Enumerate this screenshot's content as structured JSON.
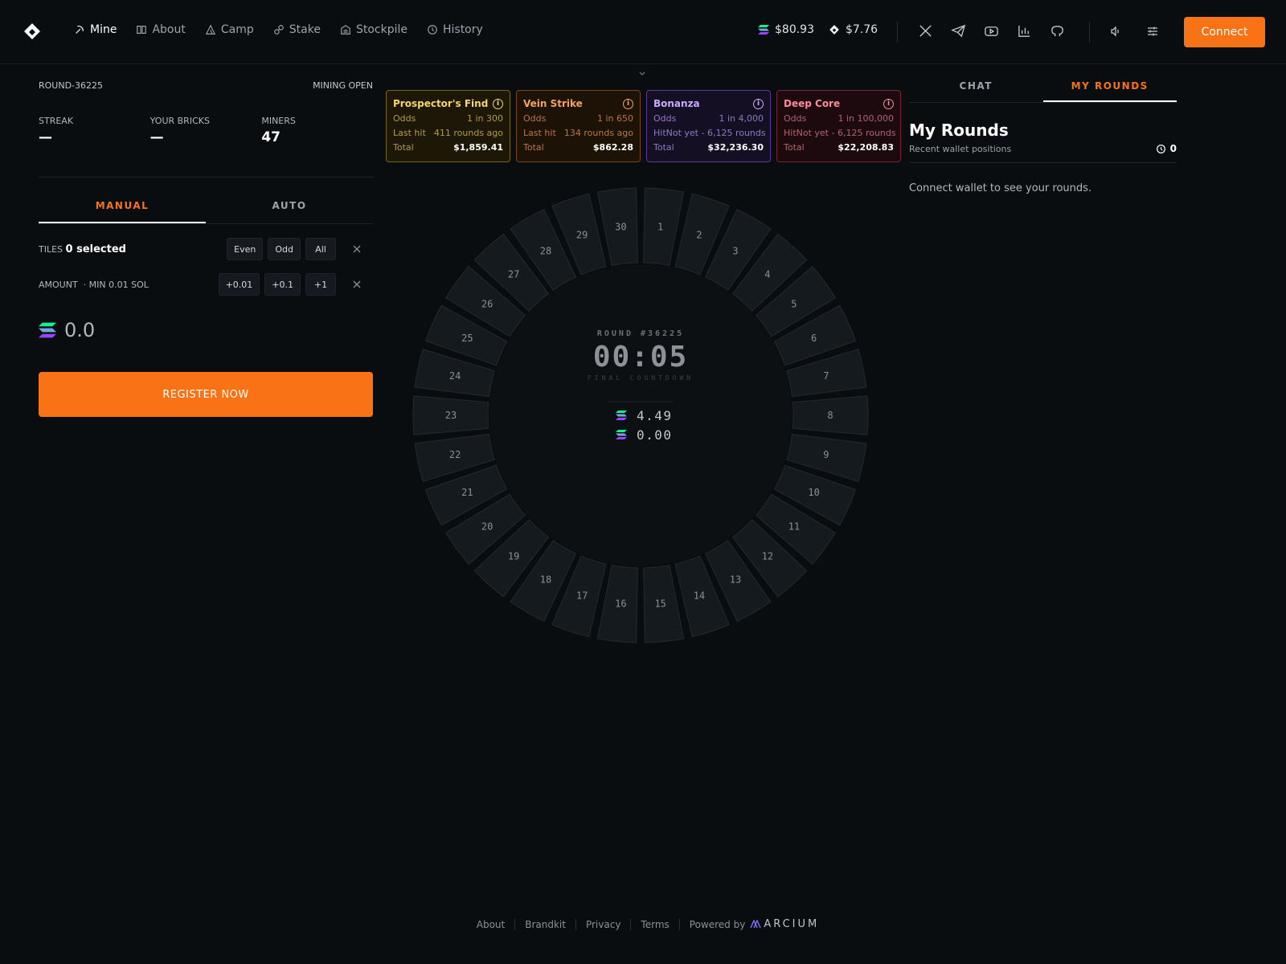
{
  "nav": {
    "items": [
      {
        "label": "Mine",
        "icon": "pickaxe-icon",
        "active": true
      },
      {
        "label": "About",
        "icon": "book-icon"
      },
      {
        "label": "Camp",
        "icon": "tent-icon"
      },
      {
        "label": "Stake",
        "icon": "link-icon"
      },
      {
        "label": "Stockpile",
        "icon": "warehouse-icon"
      },
      {
        "label": "History",
        "icon": "history-icon"
      }
    ],
    "sol_price": "$80.93",
    "token_price": "$7.76",
    "connect_label": "Connect"
  },
  "left": {
    "round_id": "ROUND-36225",
    "status": "MINING OPEN",
    "stats": [
      {
        "label": "STREAK",
        "value": "—"
      },
      {
        "label": "YOUR BRICKS",
        "value": "—"
      },
      {
        "label": "MINERS",
        "value": "47"
      }
    ],
    "tabs": {
      "manual": "MANUAL",
      "auto": "AUTO"
    },
    "tiles_label": "TILES",
    "tiles_value": "0 selected",
    "tile_buttons": [
      "Even",
      "Odd",
      "All"
    ],
    "amount_label": "AMOUNT",
    "amount_min": "· MIN 0.01 SOL",
    "amount_buttons": [
      "+0.01",
      "+0.1",
      "+1"
    ],
    "amount_value": "0.0",
    "register_label": "REGISTER NOW"
  },
  "cards": [
    {
      "name": "Prospector's Find",
      "odds_label": "Odds",
      "odds": "1 in 300",
      "hit_label": "Last hit",
      "hit": "411 rounds ago",
      "total_label": "Total",
      "total": "$1,859.41"
    },
    {
      "name": "Vein Strike",
      "odds_label": "Odds",
      "odds": "1 in 650",
      "hit_label": "Last hit",
      "hit": "134 rounds ago",
      "total_label": "Total",
      "total": "$862.28"
    },
    {
      "name": "Bonanza",
      "odds_label": "Odds",
      "odds": "1 in 4,000",
      "hit_label": "Hit",
      "hit": "Not yet - 6,125 rounds",
      "total_label": "Total",
      "total": "$32,236.30"
    },
    {
      "name": "Deep Core",
      "odds_label": "Odds",
      "odds": "1 in 100,000",
      "hit_label": "Hit",
      "hit": "Not yet - 6,125 rounds",
      "total_label": "Total",
      "total": "$22,208.83"
    }
  ],
  "wheel": {
    "round_label": "ROUND #36225",
    "timer": "00:05",
    "timer_sub": "FINAL COUNTDOWN",
    "pot": "4.49",
    "mine": "0.00",
    "tiles": [
      "1",
      "2",
      "3",
      "4",
      "5",
      "6",
      "7",
      "8",
      "9",
      "10",
      "11",
      "12",
      "13",
      "14",
      "15",
      "16",
      "17",
      "18",
      "19",
      "20",
      "21",
      "22",
      "23",
      "24",
      "25",
      "26",
      "27",
      "28",
      "29",
      "30"
    ]
  },
  "right": {
    "tabs": {
      "chat": "CHAT",
      "rounds": "MY ROUNDS"
    },
    "title": "My Rounds",
    "subtitle": "Recent wallet positions",
    "count": "0",
    "message": "Connect wallet to see your rounds."
  },
  "footer": {
    "links": [
      "About",
      "Brandkit",
      "Privacy",
      "Terms"
    ],
    "powered": "Powered by",
    "brand": "ARCIUM"
  },
  "colors": {
    "accent": "#f97316",
    "background": "#0a0d10"
  }
}
